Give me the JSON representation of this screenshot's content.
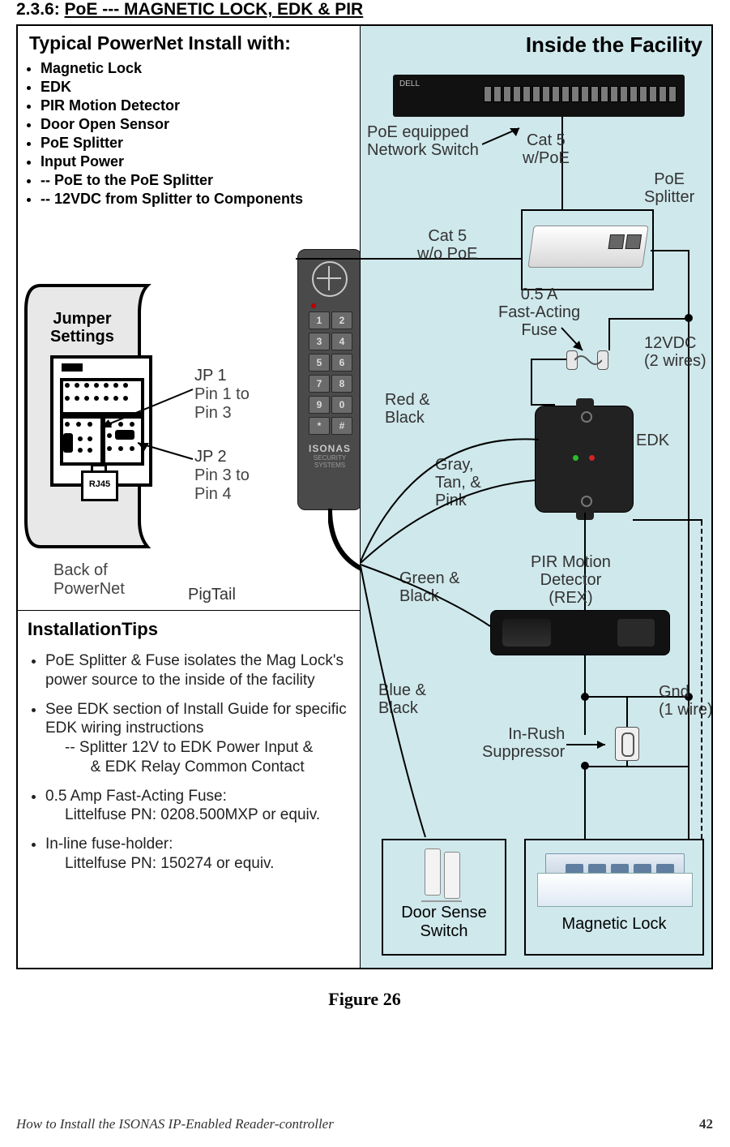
{
  "heading": {
    "num": "2.3.6: ",
    "title": "PoE --- MAGNETIC LOCK, EDK & PIR"
  },
  "install": {
    "title": "Typical PowerNet Install with:",
    "items": [
      "Magnetic Lock",
      "EDK",
      "PIR Motion Detector",
      "Door Open Sensor",
      "PoE Splitter",
      "Input Power",
      "   -- PoE to the PoE Splitter",
      "   -- 12VDC from Splitter to Components"
    ]
  },
  "jumper": {
    "title": "Jumper\nSettings",
    "jp1": "JP 1",
    "jp1_pins": "Pin 1 to\nPin 3",
    "jp2": "JP 2",
    "jp2_pins": "Pin 3 to\nPin 4",
    "rj45": "RJ45",
    "back": "Back of\nPowerNet"
  },
  "reader": {
    "brand": "ISONAS",
    "sub": "SECURITY SYSTEMS",
    "keys": [
      "1",
      "2",
      "3",
      "4",
      "5",
      "6",
      "7",
      "8",
      "9",
      "0",
      "*",
      "#"
    ]
  },
  "pigtail": "PigTail",
  "tips": {
    "title": "InstallationTips",
    "items": [
      "PoE Splitter & Fuse isolates the Mag Lock's power source to the inside of the facility",
      "See EDK section of Install Guide for specific EDK wiring instructions",
      "0.5 Amp Fast-Acting Fuse:",
      "In-line fuse-holder:"
    ],
    "sub_edk": "-- Splitter 12V to EDK Power Input &\n      & EDK Relay Common Contact",
    "sub_fuse": "Littelfuse PN:  0208.500MXP or equiv.",
    "sub_holder": "Littelfuse PN: 150274 or equiv."
  },
  "right": {
    "facility": "Inside the Facility",
    "switch_label": "PoE equipped\nNetwork Switch",
    "switch_brand": "DELL",
    "cat5_poe": "Cat 5\nw/PoE",
    "poe_splitter": "PoE\nSplitter",
    "cat5_nopoE": "Cat 5\nw/o PoE",
    "fuse": "0.5 A\nFast-Acting\nFuse",
    "v12": "12VDC\n(2 wires)",
    "red_black": "Red &\nBlack",
    "edk": "EDK",
    "gray_tan_pink": "Gray,\nTan, &\nPink",
    "pir": "PIR Motion\nDetector\n(REX)",
    "green_black": "Green &\nBlack",
    "blue_black": "Blue &\nBlack",
    "inrush": "In-Rush\nSuppressor",
    "gnd": "Gnd\n(1 wire)",
    "door_sense": "Door Sense\nSwitch",
    "maglock": "Magnetic Lock"
  },
  "figure_caption": "Figure 26",
  "footer": {
    "left": "How to Install the ISONAS IP-Enabled Reader-controller",
    "page": "42"
  }
}
